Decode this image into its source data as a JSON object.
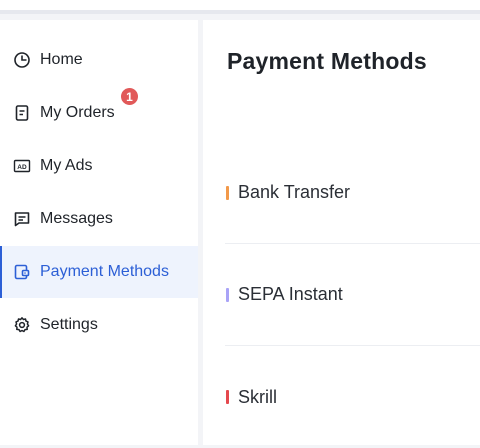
{
  "sidebar": {
    "items": [
      {
        "label": "Home",
        "icon": "clock-pie-icon"
      },
      {
        "label": "My Orders",
        "icon": "document-icon",
        "badge": "1"
      },
      {
        "label": "My Ads",
        "icon": "ad-box-icon"
      },
      {
        "label": "Messages",
        "icon": "message-icon"
      },
      {
        "label": "Payment Methods",
        "icon": "wallet-icon",
        "active": true
      },
      {
        "label": "Settings",
        "icon": "gear-icon"
      }
    ]
  },
  "main": {
    "title": "Payment Methods",
    "methods": [
      {
        "name": "Bank Transfer",
        "color": "#f2994a"
      },
      {
        "name": "SEPA Instant",
        "color": "#a9a3f7"
      },
      {
        "name": "Skrill",
        "color": "#e5484d"
      }
    ]
  },
  "colors": {
    "accent": "#2c5fd6",
    "badge": "#e15959"
  }
}
